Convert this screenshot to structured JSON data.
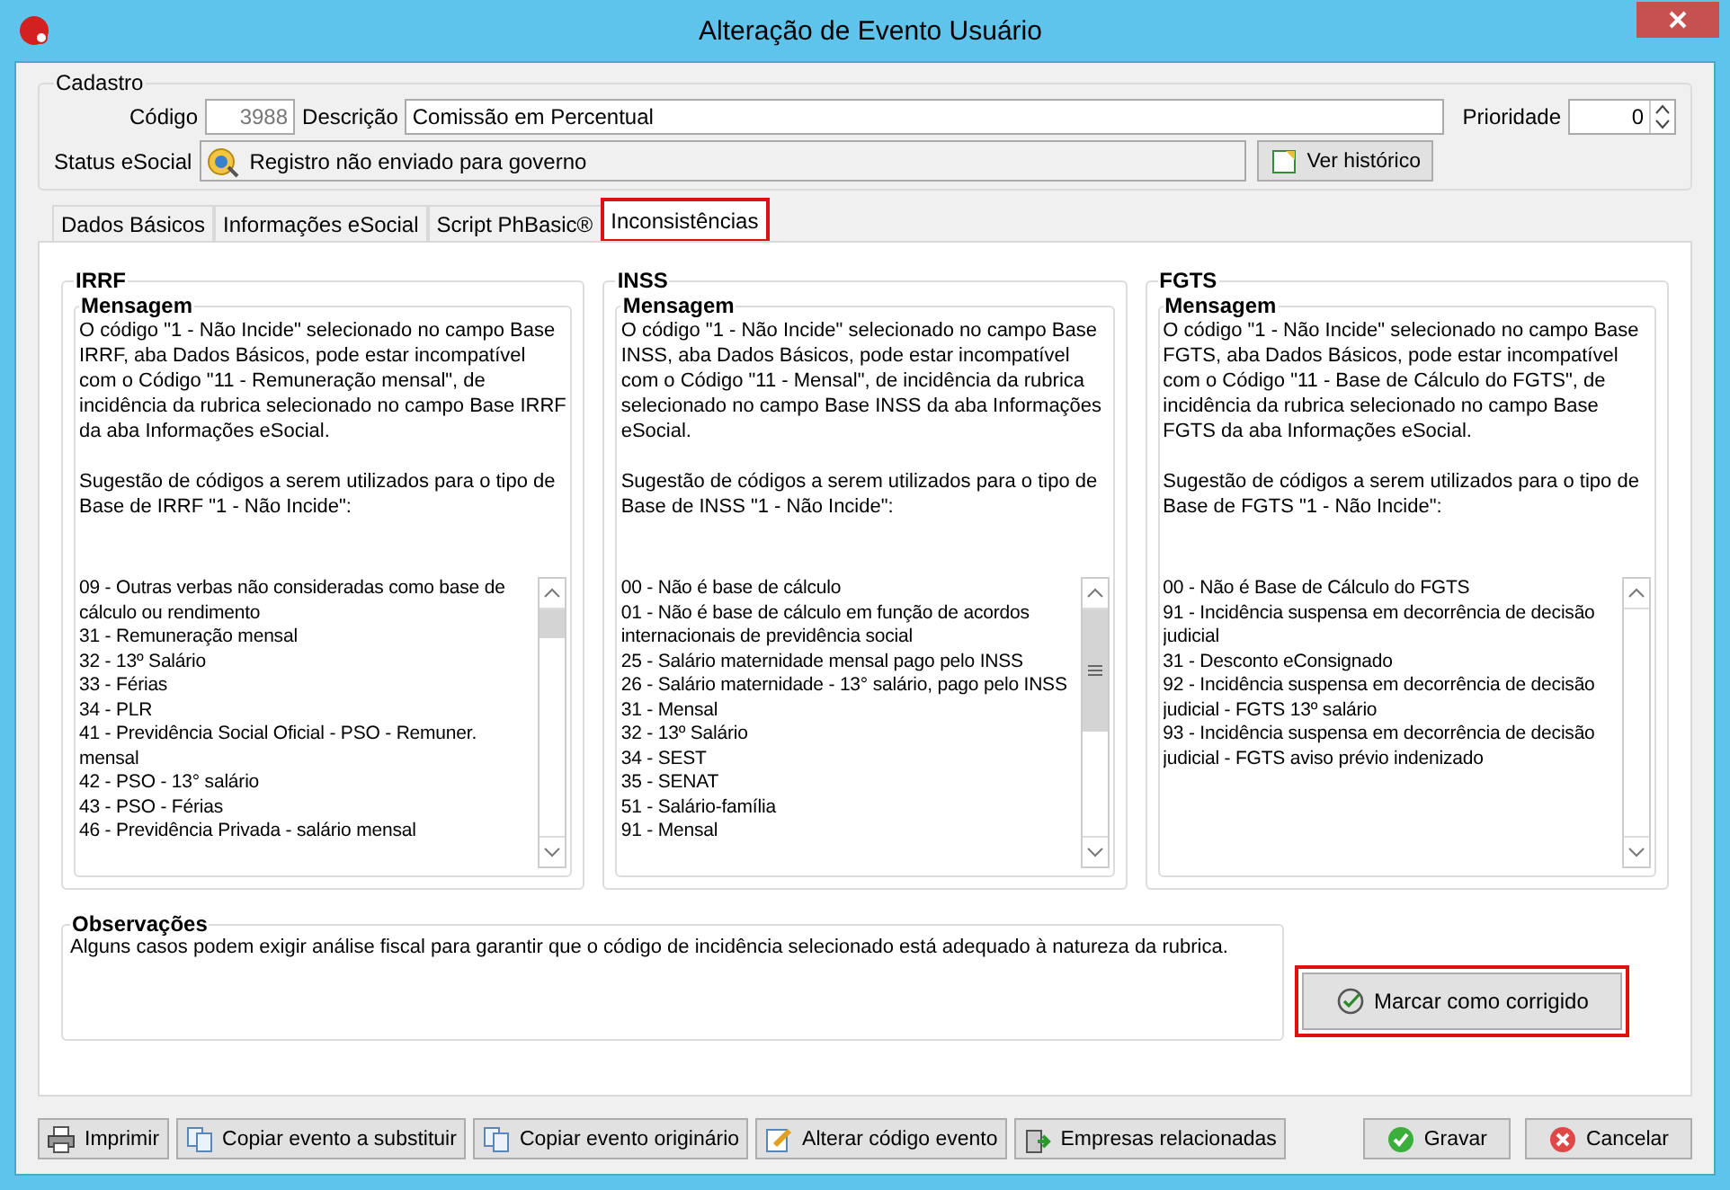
{
  "window": {
    "title": "Alteração de Evento Usuário"
  },
  "cadastro": {
    "legend": "Cadastro",
    "codigo_label": "Código",
    "codigo": "3988",
    "descricao_label": "Descrição",
    "descricao": "Comissão em Percentual",
    "prioridade_label": "Prioridade",
    "prioridade": "0",
    "status_label": "Status eSocial",
    "status": "Registro não enviado para governo",
    "historico_button": "Ver histórico"
  },
  "tabs": [
    {
      "label": "Dados Básicos",
      "selected": false,
      "highlighted": false
    },
    {
      "label": "Informações eSocial",
      "selected": false,
      "highlighted": false
    },
    {
      "label": "Script PhBasic®",
      "selected": false,
      "highlighted": false
    },
    {
      "label": "Inconsistências",
      "selected": true,
      "highlighted": true
    }
  ],
  "groups": [
    {
      "title": "IRRF",
      "message_legend": "Mensagem",
      "message": "O código \"1 - Não Incide\" selecionado no campo Base IRRF, aba Dados Básicos, pode estar incompatível com o Código \"11 - Remuneração mensal\", de incidência da rubrica selecionado no campo Base IRRF da aba Informações eSocial.",
      "suggestion": "Sugestão de códigos a serem utilizados para o tipo de Base de IRRF \"1 - Não Incide\":",
      "codes": [
        "09 - Outras verbas não consideradas como base de cálculo ou rendimento",
        "31 - Remuneração mensal",
        "32 - 13º Salário",
        "33 - Férias",
        "34 - PLR",
        "41 - Previdência Social Oficial - PSO - Remuner. mensal",
        "42 - PSO - 13° salário",
        "43 - PSO - Férias",
        "46 - Previdência Privada - salário mensal"
      ]
    },
    {
      "title": "INSS",
      "message_legend": "Mensagem",
      "message": "O código \"1 - Não Incide\" selecionado no campo Base INSS, aba Dados Básicos, pode estar incompatível com o Código \"11 - Mensal\", de incidência da rubrica selecionado no campo Base INSS da aba Informações eSocial.",
      "suggestion": "Sugestão de códigos a serem utilizados para o tipo de Base de INSS \"1 - Não Incide\":",
      "codes": [
        "00 - Não é base de cálculo",
        "01 - Não é base de cálculo em função de acordos internacionais de previdência social",
        "25 - Salário maternidade mensal pago pelo INSS",
        "26 - Salário maternidade - 13° salário, pago pelo INSS",
        "31 - Mensal",
        "32 - 13º Salário",
        "34 - SEST",
        "35 - SENAT",
        "51 - Salário-família",
        "91 - Mensal"
      ]
    },
    {
      "title": "FGTS",
      "message_legend": "Mensagem",
      "message": "O código \"1 - Não Incide\" selecionado no campo Base FGTS, aba Dados Básicos, pode estar incompatível com o Código \"11 - Base de Cálculo do FGTS\", de incidência da rubrica selecionado no campo Base FGTS da aba Informações eSocial.",
      "suggestion": "Sugestão de códigos a serem utilizados para o tipo de Base de FGTS \"1 - Não Incide\":",
      "codes": [
        "00 - Não é Base de Cálculo do FGTS",
        "91 - Incidência suspensa em decorrência de decisão judicial",
        "31 - Desconto eConsignado",
        "92 - Incidência suspensa em decorrência de decisão judicial - FGTS 13º salário",
        "93 - Incidência suspensa em decorrência de decisão judicial - FGTS aviso prévio indenizado"
      ]
    }
  ],
  "observacoes": {
    "legend": "Observações",
    "text": "Alguns casos podem exigir análise fiscal para garantir que o código de incidência selecionado está adequado à natureza da rubrica."
  },
  "mark_button": {
    "label": "Marcar como corrigido",
    "highlighted": true
  },
  "buttons": [
    {
      "label": "Imprimir"
    },
    {
      "label": "Copiar evento a substituir"
    },
    {
      "label": "Copiar evento originário"
    },
    {
      "label": "Alterar código evento"
    },
    {
      "label": "Empresas relacionadas"
    },
    {
      "label": "Gravar"
    },
    {
      "label": "Cancelar"
    }
  ]
}
